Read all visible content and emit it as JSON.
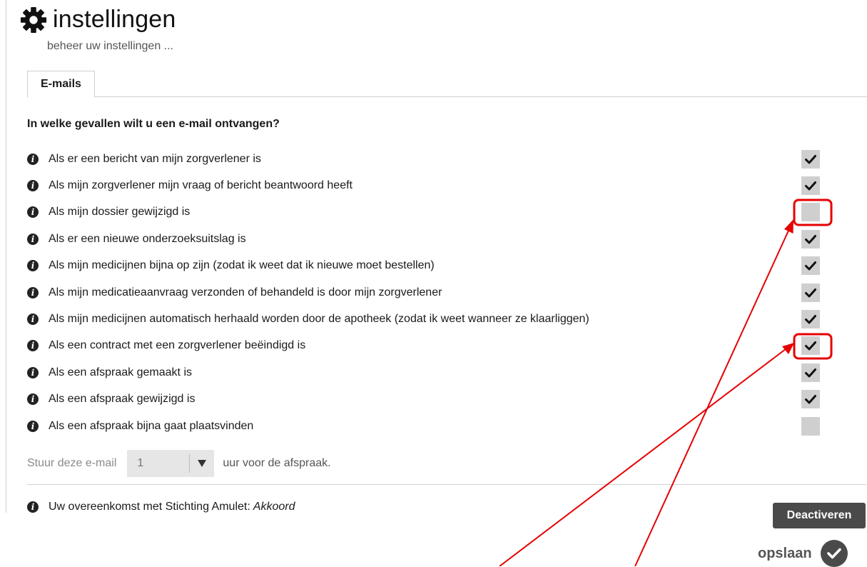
{
  "header": {
    "icon": "gear-icon",
    "title": "instellingen",
    "subtitle": "beheer uw instellingen ..."
  },
  "tabs": [
    {
      "label": "E-mails",
      "active": true
    }
  ],
  "question": "In welke gevallen wilt u een e-mail ontvangen?",
  "options": [
    {
      "label": "Als er een bericht van mijn zorgverlener is",
      "checked": true
    },
    {
      "label": "Als mijn zorgverlener mijn vraag of bericht beantwoord heeft",
      "checked": true
    },
    {
      "label": "Als mijn dossier gewijzigd is",
      "checked": false
    },
    {
      "label": "Als er een nieuwe onderzoeksuitslag is",
      "checked": true
    },
    {
      "label": "Als mijn medicijnen bijna op zijn (zodat ik weet dat ik nieuwe moet bestellen)",
      "checked": true
    },
    {
      "label": "Als mijn medicatieaanvraag verzonden of behandeld is door mijn zorgverlener",
      "checked": true
    },
    {
      "label": "Als mijn medicijnen automatisch herhaald worden door de apotheek (zodat ik weet wanneer ze klaarliggen)",
      "checked": true
    },
    {
      "label": "Als een contract met een zorgverlener beëindigd is",
      "checked": true
    },
    {
      "label": "Als een afspraak gemaakt is",
      "checked": true
    },
    {
      "label": "Als een afspraak gewijzigd is",
      "checked": true
    },
    {
      "label": "Als een afspraak bijna gaat plaatsvinden",
      "checked": false
    }
  ],
  "reminder": {
    "prefix": "Stuur deze e-mail",
    "selected": "1",
    "suffix": "uur voor de afspraak."
  },
  "agreement": {
    "text": "Uw overeenkomst met Stichting Amulet:",
    "status": "Akkoord"
  },
  "buttons": {
    "deactivate": "Deactiveren",
    "save": "opslaan"
  },
  "colors": {
    "annotation": "#e60000",
    "checkbox": "#cfcfcf",
    "button": "#4a4a4a"
  }
}
